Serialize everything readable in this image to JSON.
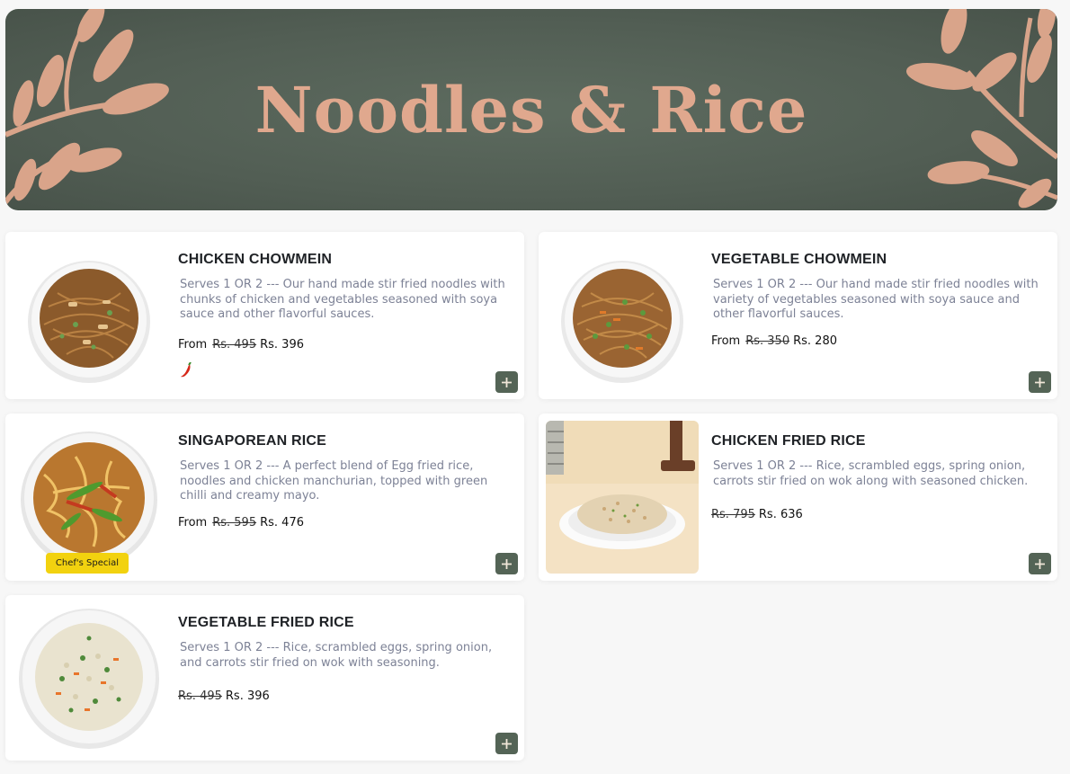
{
  "banner": {
    "title": "Noodles & Rice"
  },
  "items": [
    {
      "name": "CHICKEN CHOWMEIN",
      "description": "Serves 1 OR 2 --- Our hand made stir fried noodles with chunks of chicken and vegetables seasoned with soya sauce and other flavorful sauces.",
      "from_label": "From",
      "old_price": "Rs. 495",
      "price": "Rs. 396",
      "icon": "chili-icon"
    },
    {
      "name": "VEGETABLE CHOWMEIN",
      "description": "Serves 1 OR 2 --- Our hand made stir fried noodles with variety of vegetables seasoned with soya sauce and other flavorful sauces.",
      "from_label": "From",
      "old_price": "Rs. 350",
      "price": "Rs. 280"
    },
    {
      "name": "SINGAPOREAN RICE",
      "description": "Serves 1 OR 2 --- A perfect blend of Egg fried rice, noodles and chicken manchurian, topped with green chilli and creamy mayo.",
      "from_label": "From",
      "old_price": "Rs. 595",
      "price": "Rs. 476",
      "badge": "Chef's Special"
    },
    {
      "name": "CHICKEN FRIED RICE",
      "description": "Serves 1 OR 2 --- Rice, scrambled eggs, spring onion, carrots stir fried on wok along with seasoned chicken.",
      "old_price": "Rs. 795",
      "price": "Rs. 636"
    },
    {
      "name": "VEGETABLE FRIED RICE",
      "description": "Serves 1 OR 2 --- Rice, scrambled eggs, spring onion, and carrots stir fried on wok with seasoning.",
      "old_price": "Rs. 495",
      "price": "Rs. 396"
    }
  ],
  "colors": {
    "banner_bg": "#525e54",
    "accent": "#e0a88e",
    "button_bg": "#546456",
    "badge_bg": "#f2d20f"
  }
}
